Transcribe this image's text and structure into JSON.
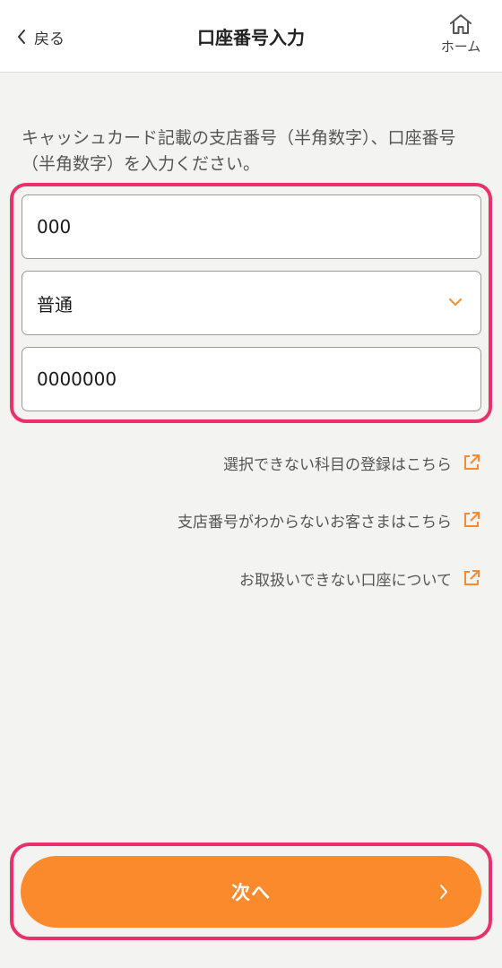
{
  "header": {
    "back_label": "戻る",
    "title": "口座番号入力",
    "home_label": "ホーム"
  },
  "instruction": "キャッシュカード記載の支店番号（半角数字）、口座番号（半角数字）を入力ください。",
  "form": {
    "branch_value": "000",
    "account_type_selected": "普通",
    "account_number_value": "0000000"
  },
  "links": [
    {
      "label": "選択できない科目の登録はこちら",
      "icon": "external-link-icon"
    },
    {
      "label": "支店番号がわからないお客さまはこちら",
      "icon": "external-link-icon"
    },
    {
      "label": "お取扱いできない口座について",
      "icon": "external-link-icon"
    }
  ],
  "next_button": {
    "label": "次へ"
  },
  "colors": {
    "accent": "#fb8a2c",
    "highlight_frame": "#e8336a",
    "background": "#f3f3f2"
  }
}
